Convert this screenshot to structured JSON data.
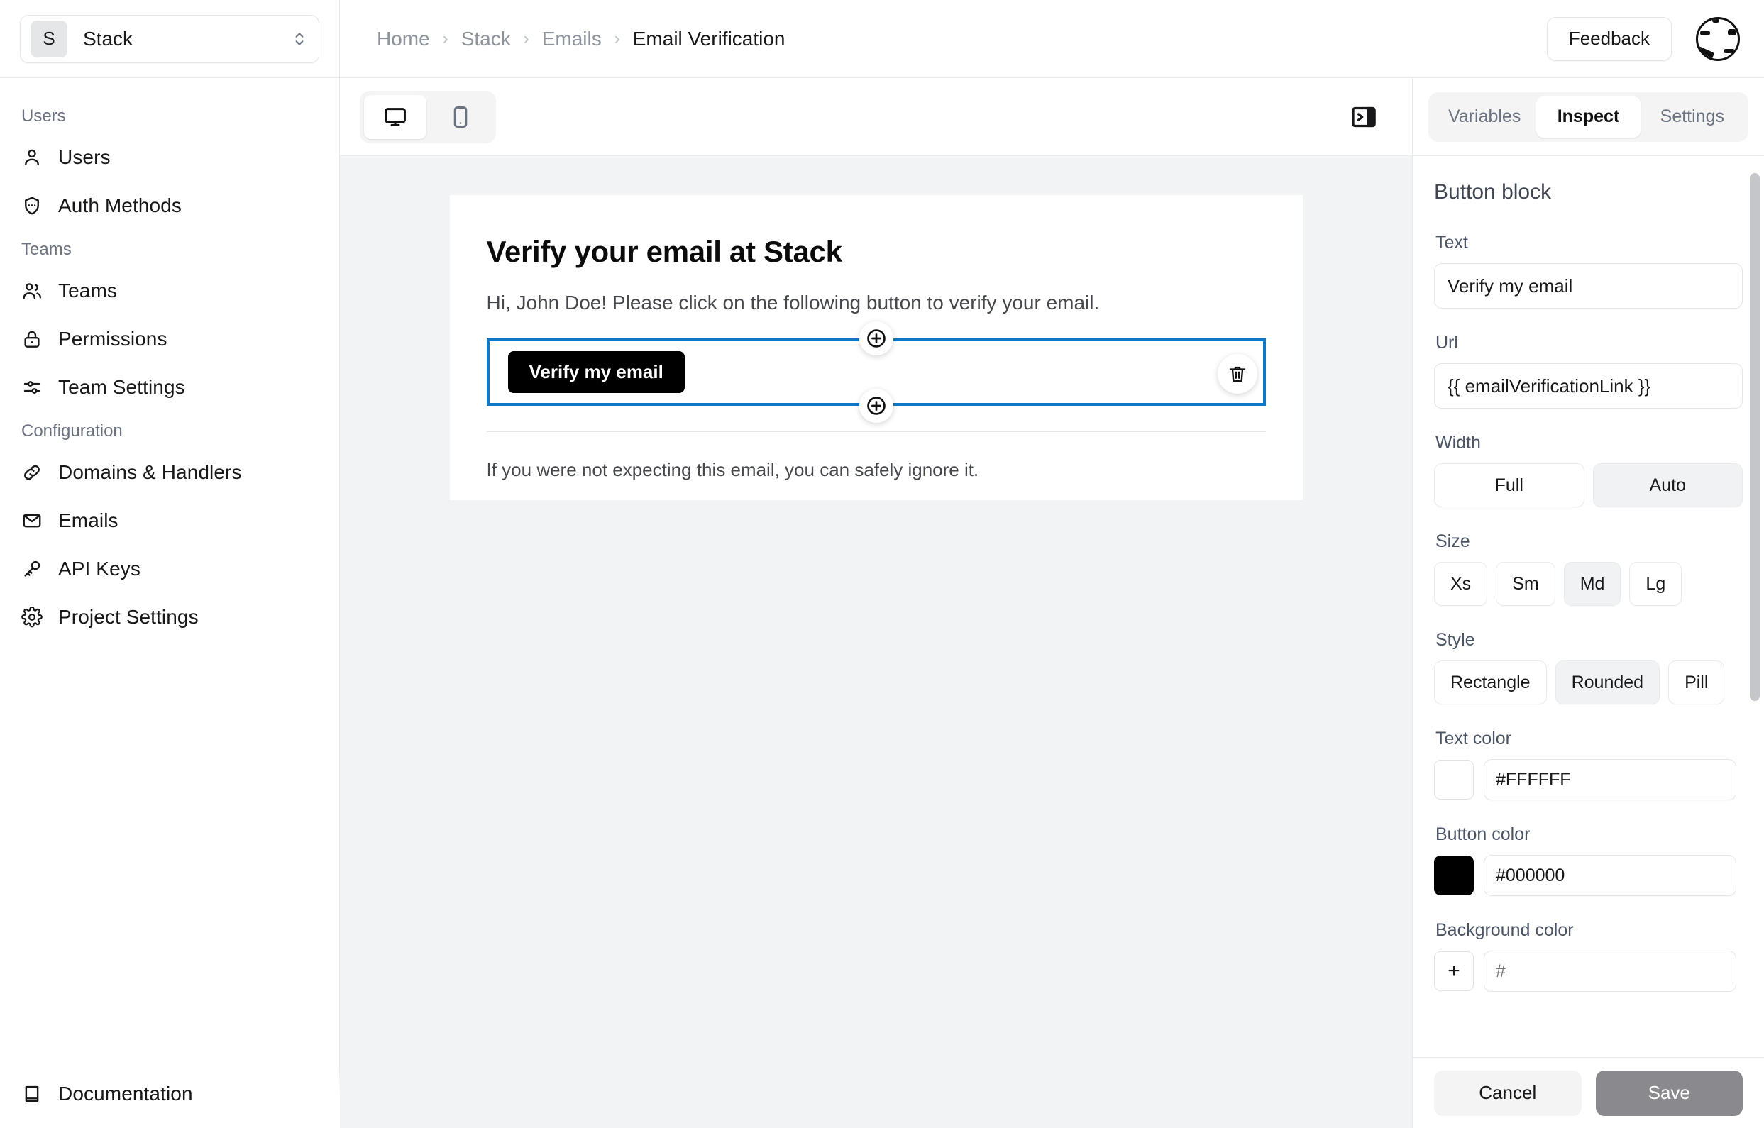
{
  "sidebar": {
    "project": {
      "badge": "S",
      "name": "Stack"
    },
    "groups": [
      {
        "label": "Users",
        "items": [
          {
            "label": "Users",
            "icon": "user-icon"
          },
          {
            "label": "Auth Methods",
            "icon": "shield-icon"
          }
        ]
      },
      {
        "label": "Teams",
        "items": [
          {
            "label": "Teams",
            "icon": "users-icon"
          },
          {
            "label": "Permissions",
            "icon": "lock-icon"
          },
          {
            "label": "Team Settings",
            "icon": "sliders-icon"
          }
        ]
      },
      {
        "label": "Configuration",
        "items": [
          {
            "label": "Domains & Handlers",
            "icon": "link-icon"
          },
          {
            "label": "Emails",
            "icon": "mail-icon"
          },
          {
            "label": "API Keys",
            "icon": "key-icon"
          },
          {
            "label": "Project Settings",
            "icon": "gear-icon"
          }
        ]
      }
    ],
    "footer": {
      "label": "Documentation",
      "icon": "book-icon"
    }
  },
  "topbar": {
    "breadcrumbs": [
      "Home",
      "Stack",
      "Emails",
      "Email Verification"
    ],
    "separator": "›",
    "feedback_label": "Feedback"
  },
  "editor": {
    "devices": [
      {
        "name": "desktop",
        "icon": "monitor-icon",
        "active": true
      },
      {
        "name": "mobile",
        "icon": "phone-icon",
        "active": false
      }
    ],
    "collapse_icon": "panel-collapse-icon",
    "email": {
      "heading": "Verify your email at Stack",
      "greeting": "Hi, John Doe! Please click on the following button to verify your email.",
      "button_label": "Verify my email",
      "footer": "If you were not expecting this email, you can safely ignore it."
    },
    "handles": {
      "add": "+",
      "delete_icon": "trash-icon"
    },
    "selection_color": "#0E78C8"
  },
  "inspector": {
    "tabs": [
      {
        "label": "Variables",
        "active": false
      },
      {
        "label": "Inspect",
        "active": true
      },
      {
        "label": "Settings",
        "active": false
      }
    ],
    "title": "Button block",
    "fields": {
      "text": {
        "label": "Text",
        "value": "Verify my email"
      },
      "url": {
        "label": "Url",
        "value": "{{ emailVerificationLink }}"
      },
      "width": {
        "label": "Width",
        "options": [
          "Full",
          "Auto"
        ],
        "selected": "Auto"
      },
      "size": {
        "label": "Size",
        "options": [
          "Xs",
          "Sm",
          "Md",
          "Lg"
        ],
        "selected": "Md"
      },
      "style": {
        "label": "Style",
        "options": [
          "Rectangle",
          "Rounded",
          "Pill"
        ],
        "selected": "Rounded"
      },
      "text_color": {
        "label": "Text color",
        "value": "#FFFFFF",
        "swatch": "#FFFFFF"
      },
      "button_color": {
        "label": "Button color",
        "value": "#000000",
        "swatch": "#000000"
      },
      "background_color": {
        "label": "Background color",
        "value": "",
        "placeholder": "#",
        "add_glyph": "+"
      }
    },
    "actions": {
      "cancel": "Cancel",
      "save": "Save"
    }
  }
}
